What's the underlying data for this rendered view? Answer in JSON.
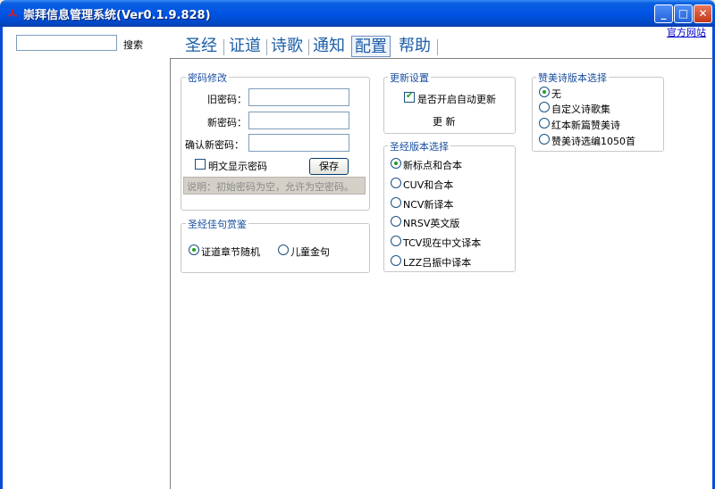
{
  "window": {
    "title": "崇拜信息管理系统(Ver0.1.9.828)",
    "app_icon_glyph": "ㅅ",
    "minimize_glyph": "_",
    "maximize_glyph": "□",
    "close_glyph": "✕"
  },
  "sidebar": {
    "search_value": "",
    "search_label": "搜索"
  },
  "header": {
    "official_link": "官方网站"
  },
  "tabs": [
    {
      "label": "圣经"
    },
    {
      "label": "证道"
    },
    {
      "label": "诗歌"
    },
    {
      "label": "通知"
    },
    {
      "label": "配置"
    },
    {
      "label": "帮助"
    }
  ],
  "active_tab": "配置",
  "password_group": {
    "title": "密码修改",
    "old_label": "旧密码：",
    "new_label": "新密码：",
    "confirm_label": "确认新密码：",
    "old_value": "",
    "new_value": "",
    "confirm_value": "",
    "show_plain_label": "明文显示密码",
    "show_plain_checked": false,
    "save_label": "保存",
    "note": "说明：初始密码为空，允许为空密码。"
  },
  "verse_group": {
    "title": "圣经佳句赏鉴",
    "options": [
      {
        "label": "证道章节随机",
        "checked": true
      },
      {
        "label": "儿童金句",
        "checked": false
      }
    ]
  },
  "update_group": {
    "title": "更新设置",
    "auto_update_label": "是否开启自动更新",
    "auto_update_checked": true,
    "update_button": "更 新"
  },
  "bible_version_group": {
    "title": "圣经版本选择",
    "options": [
      {
        "label": "新标点和合本",
        "checked": true
      },
      {
        "label": "CUV和合本",
        "checked": false
      },
      {
        "label": "NCV新译本",
        "checked": false
      },
      {
        "label": "NRSV英文版",
        "checked": false
      },
      {
        "label": "TCV现在中文译本",
        "checked": false
      },
      {
        "label": "LZZ吕振中译本",
        "checked": false
      }
    ]
  },
  "hymn_version_group": {
    "title": "赞美诗版本选择",
    "options": [
      {
        "label": "无",
        "checked": true
      },
      {
        "label": "自定义诗歌集",
        "checked": false
      },
      {
        "label": "红本新篇赞美诗",
        "checked": false
      },
      {
        "label": "赞美诗选编1050首",
        "checked": false
      }
    ]
  },
  "colors": {
    "accent": "#1b5ea8",
    "titlebar": "#0054e3",
    "radio_dot": "#21a121"
  }
}
